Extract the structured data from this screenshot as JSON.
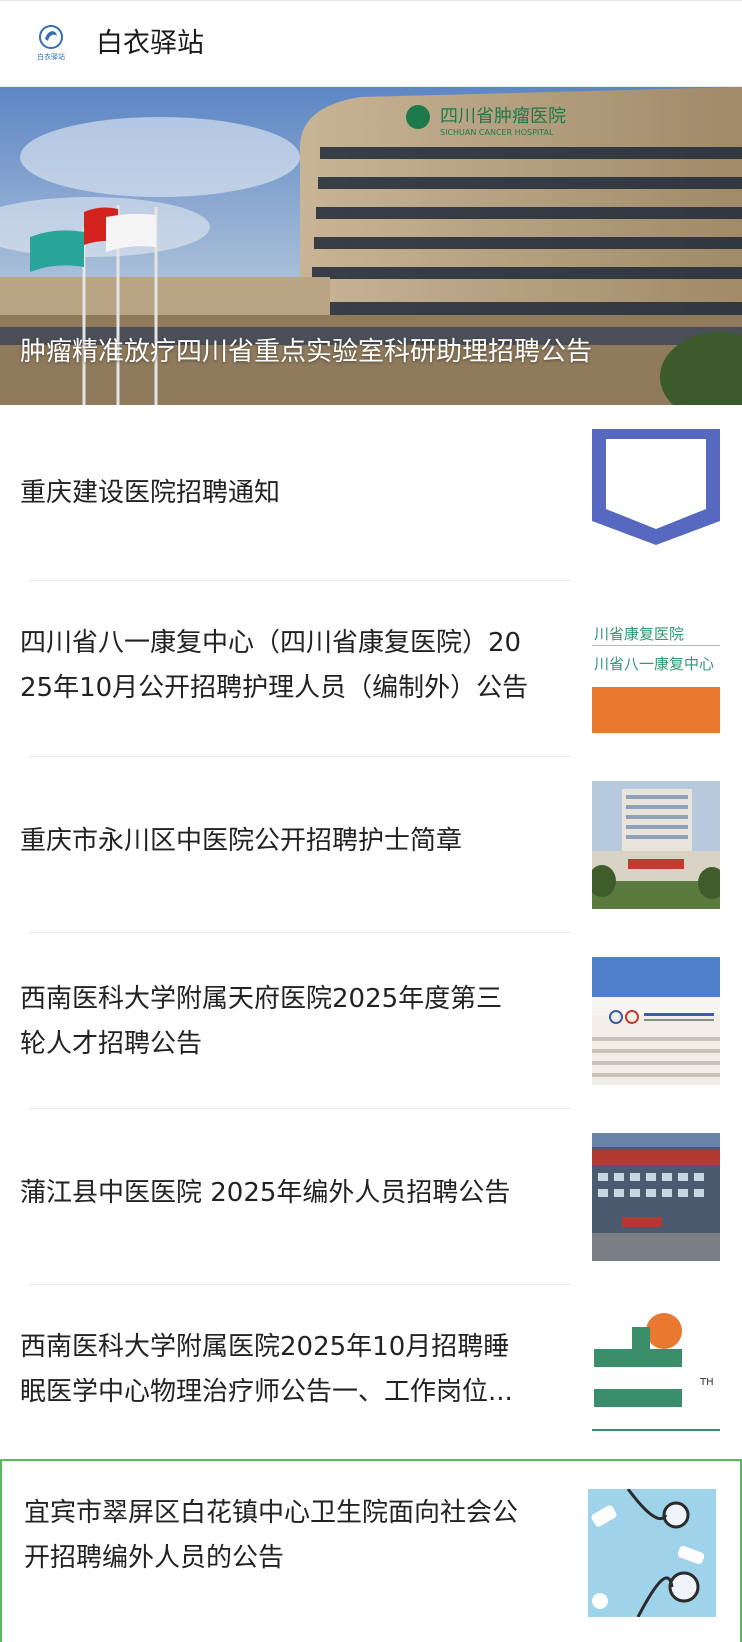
{
  "header": {
    "title": "白衣驿站",
    "logo_text": "白衣驿站"
  },
  "banner": {
    "title": "肿瘤精准放疗四川省重点实验室科研助理招聘公告",
    "sign_text": "四川省肿瘤医院",
    "sign_subtext": "SICHUAN CANCER HOSPITAL"
  },
  "articles": [
    {
      "title_lines": [
        "重庆建设医院招聘通知"
      ],
      "thumb": "blue-shield-logo"
    },
    {
      "title_lines": [
        "四川省八一康复中心（四川省康复医院）20",
        "25年10月公开招聘护理人员（编制外）公告"
      ],
      "thumb": "rehab-center-sign",
      "thumb_text_1": "川省康复医院",
      "thumb_text_2": "川省八一康复中心"
    },
    {
      "title_lines": [
        "重庆市永川区中医院公开招聘护士简章"
      ],
      "thumb": "hospital-building-photo"
    },
    {
      "title_lines": [
        "西南医科大学附属天府医院2025年度第三",
        "轮人才招聘公告"
      ],
      "thumb": "tianfu-hospital-photo"
    },
    {
      "title_lines": [
        "蒲江县中医医院 2025年编外人员招聘公告"
      ],
      "thumb": "pujiang-hospital-photo"
    },
    {
      "title_lines": [
        "西南医科大学附属医院2025年10月招聘睡",
        "眠医学中心物理治疗师公告一、工作岗位..."
      ],
      "thumb": "university-hospital-logo",
      "thumb_text": "TH"
    },
    {
      "title_lines": [
        "宜宾市翠屏区白花镇中心卫生院面向社会公",
        "开招聘编外人员的公告"
      ],
      "thumb": "stethoscope-photo"
    }
  ],
  "colors": {
    "accent_green": "#5cb85c",
    "divider": "#e9e9e9",
    "shield_blue": "#5668c0",
    "rehab_orange": "#e8792e",
    "logo_green": "#3a8f6a"
  }
}
